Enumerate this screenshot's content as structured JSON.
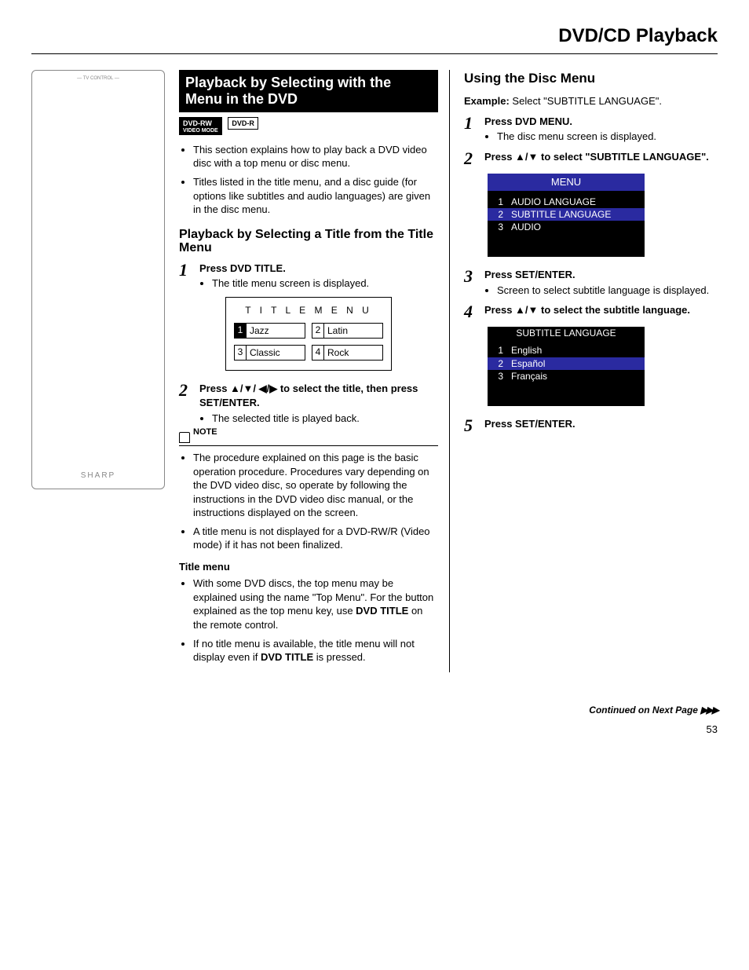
{
  "page_title": "DVD/CD Playback",
  "page_number": "53",
  "continued": "Continued on Next Page",
  "remote": {
    "brand": "SHARP",
    "placeholder": "— TV CONTROL —"
  },
  "banner_title": "Playback by Selecting with the Menu in the DVD",
  "badges": {
    "rw": "DVD-RW",
    "rw_sub": "VIDEO MODE",
    "r": "DVD-R"
  },
  "intro_bullets": [
    "This section explains how to play back a DVD video disc with a top menu or disc menu.",
    "Titles listed in the title menu, and a disc guide (for options like subtitles and audio languages) are given in the disc menu."
  ],
  "title_section_heading": "Playback by Selecting a Title from the Title Menu",
  "step1": {
    "instr_pre": "Press ",
    "instr_btn": "DVD TITLE",
    "instr_post": ".",
    "sub": "The title menu screen is displayed."
  },
  "title_menu": {
    "header": "T I T L E   M E N U",
    "items": [
      {
        "n": "1",
        "label": "Jazz",
        "selected": true
      },
      {
        "n": "2",
        "label": "Latin",
        "selected": false
      },
      {
        "n": "3",
        "label": "Classic",
        "selected": false
      },
      {
        "n": "4",
        "label": "Rock",
        "selected": false
      }
    ]
  },
  "step2": {
    "instr_pre": "Press ",
    "arrows": "▲/▼/ ◀/▶",
    "instr_mid": " to select the title, then press ",
    "instr_btn": "SET/ENTER",
    "instr_post": ".",
    "sub": "The selected title is played back."
  },
  "note_label": "NOTE",
  "note_bullets": [
    "The procedure explained on this page is the basic operation procedure. Procedures vary depending on the DVD video disc, so operate by following the instructions in the DVD video disc manual, or the instructions displayed on the screen.",
    "A title menu is not displayed for a DVD-RW/R (Video mode) if it has not been finalized."
  ],
  "title_menu_sub_heading": "Title menu",
  "title_menu_sub_bullets_a": "With some DVD discs, the top menu may be explained using the name \"Top Menu\". For the button explained as the top menu key, use ",
  "title_menu_sub_bold": "DVD TITLE",
  "title_menu_sub_bullets_a2": " on the remote control.",
  "title_menu_sub_bullets_b": "If no title menu is available, the title menu will not display even if ",
  "title_menu_sub_bold2": "DVD TITLE",
  "title_menu_sub_bullets_b2": " is pressed.",
  "right_heading": "Using the Disc Menu",
  "example_label": "Example:",
  "example_text": " Select \"SUBTITLE LANGUAGE\".",
  "rstep1": {
    "pre": "Press ",
    "btn": "DVD MENU",
    "post": ".",
    "sub": "The disc menu screen is displayed."
  },
  "rstep2": {
    "pre": "Press ",
    "arrows": "▲/▼",
    "mid": " to select \"SUBTITLE LANGUAGE\"."
  },
  "osd1_header": "MENU",
  "osd1_items": [
    {
      "n": "1",
      "label": "AUDIO LANGUAGE",
      "selected": false
    },
    {
      "n": "2",
      "label": "SUBTITLE LANGUAGE",
      "selected": true
    },
    {
      "n": "3",
      "label": "AUDIO",
      "selected": false
    }
  ],
  "rstep3": {
    "pre": "Press ",
    "btn": "SET/ENTER",
    "post": ".",
    "sub": "Screen to select subtitle language is displayed."
  },
  "rstep4": {
    "pre": "Press ",
    "arrows": "▲/▼",
    "mid": " to select the subtitle language."
  },
  "osd2_title": "SUBTITLE LANGUAGE",
  "osd2_items": [
    {
      "n": "1",
      "label": "English",
      "selected": false
    },
    {
      "n": "2",
      "label": "Español",
      "selected": true
    },
    {
      "n": "3",
      "label": "Français",
      "selected": false
    }
  ],
  "rstep5": {
    "pre": "Press ",
    "btn": "SET/ENTER",
    "post": "."
  }
}
